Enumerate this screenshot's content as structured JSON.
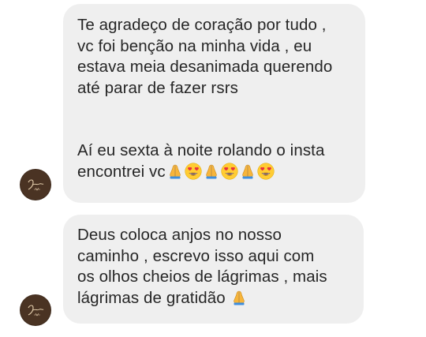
{
  "messages": [
    {
      "lines": [
        "Te agradeço de coração por tudo ,",
        "vc foi benção na minha vida , eu",
        "estava meia desanimada querendo",
        "até parar de fazer rsrs",
        "Aí eu sexta à noite rolando o insta",
        "encontrei vc"
      ],
      "emojis": [
        "folded-hands-icon",
        "heart-eyes-icon",
        "folded-hands-icon",
        "heart-eyes-icon",
        "folded-hands-icon",
        "heart-eyes-icon"
      ]
    },
    {
      "lines": [
        "Deus coloca anjos no nosso",
        "caminho , escrevo isso aqui com",
        "os olhos cheios de lágrimas , mais",
        "lágrimas de gratidão"
      ],
      "emojis": [
        "folded-hands-icon"
      ]
    }
  ],
  "colors": {
    "bubble": "#efefef",
    "text": "#262626",
    "avatar": "#4a3323",
    "emoji_face": "#FFCC33",
    "heart": "#E8323C",
    "hands": "#F7B53B"
  }
}
